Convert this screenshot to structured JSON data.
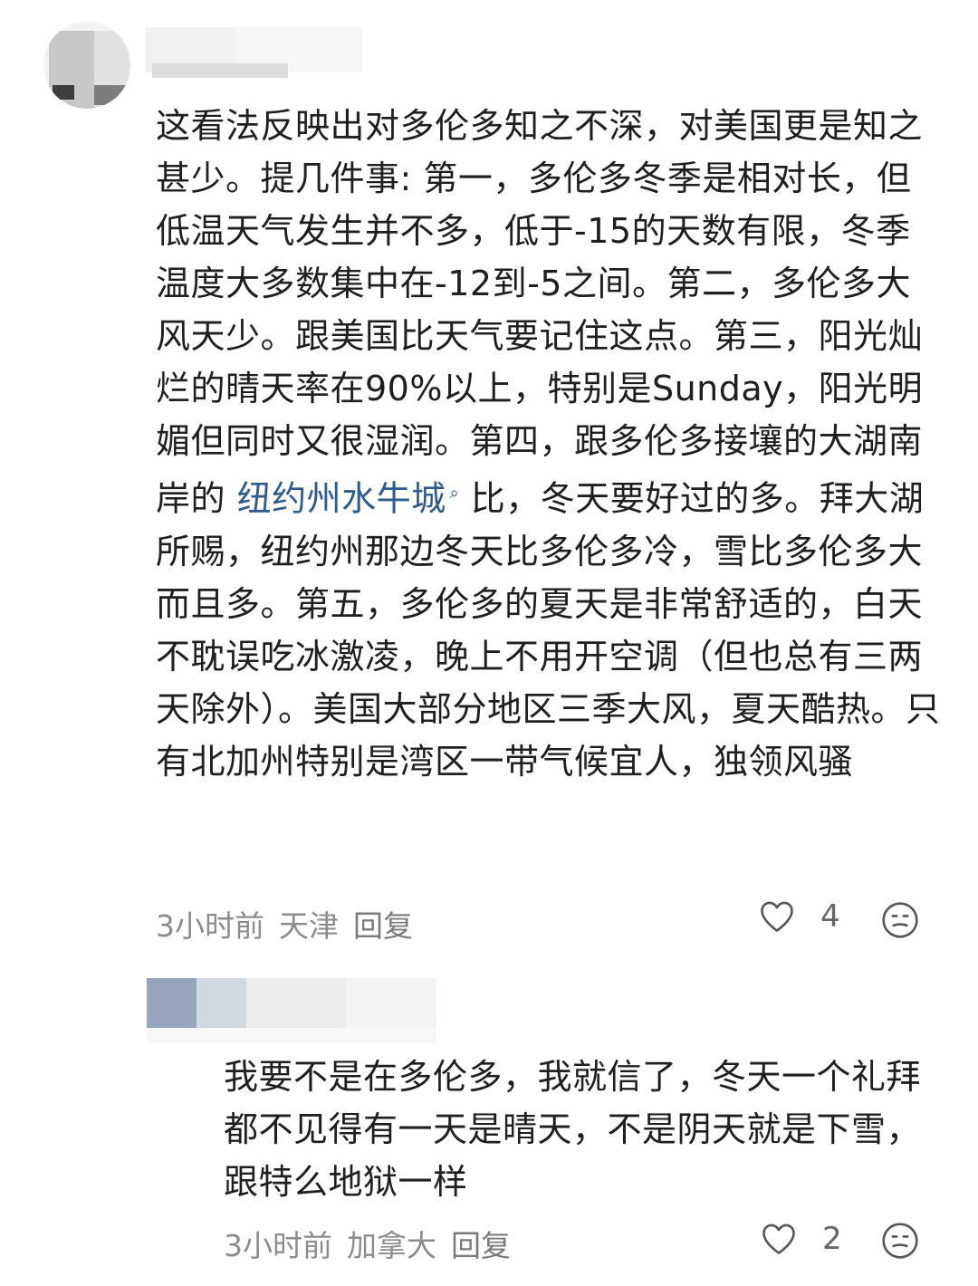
{
  "comments": [
    {
      "paragraph": "这看法反映出对多伦多知之不深，对美国更是知之甚少。提几件事: 第一，多伦多冬季是相对长，但低温天气发生并不多，低于-15的天数有限，冬季温度大多数集中在-12到-5之间。第二，多伦多大风天少。跟美国比天气要记住这点。第三，阳光灿烂的晴天率在90%以上，特别是Sunday，阳光明媚但同时又很湿润。第四，跟多伦多接壤的大湖南岸的 ",
      "link_text": "纽约州水牛城",
      "link_icon": "search-icon",
      "paragraph_after": " 比，冬天要好过的多。拜大湖所赐，纽约州那边冬天比多伦多冷，雪比多伦多大而且多。第五，多伦多的夏天是非常舒适的，白天不耽误吃冰激凌，晚上不用开空调（但也总有三两天除外）。美国大部分地区三季大风，夏天酷热。只有北加州特别是湾区一带气候宜人，独领风骚",
      "time": "3小时前",
      "location": "天津",
      "reply_label": "回复",
      "like_count": "4"
    },
    {
      "paragraph": "我要不是在多伦多，我就信了，冬天一个礼拜都不见得有一天是晴天，不是阴天就是下雪，跟特么地狱一样",
      "time": "3小时前",
      "location": "加拿大",
      "reply_label": "回复",
      "like_count": "2"
    }
  ],
  "icons": {
    "like": "heart-outline-icon",
    "emoji": "emoji-face-icon"
  },
  "colors": {
    "link": "#2d5b8c",
    "meta": "#8c8c8c"
  }
}
